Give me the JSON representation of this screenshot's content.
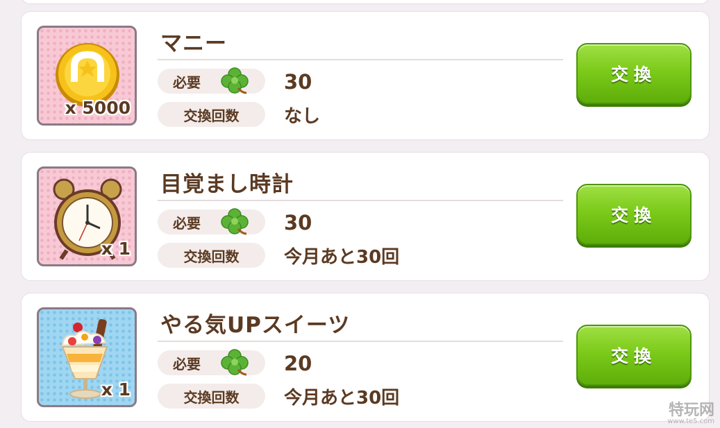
{
  "items": [
    {
      "name": "マニー",
      "quantity": "x 5000",
      "icon": "coin-icon",
      "required_label": "必要",
      "required_value": "30",
      "count_label": "交換回数",
      "count_value": "なし",
      "button_label": "交換"
    },
    {
      "name": "目覚まし時計",
      "quantity": "x 1",
      "icon": "alarm-clock-icon",
      "required_label": "必要",
      "required_value": "30",
      "count_label": "交換回数",
      "count_value": "今月あと30回",
      "button_label": "交換"
    },
    {
      "name": "やる気UPスイーツ",
      "quantity": "x 1",
      "icon": "parfait-icon",
      "required_label": "必要",
      "required_value": "20",
      "count_label": "交換回数",
      "count_value": "今月あと30回",
      "button_label": "交換"
    }
  ],
  "watermark": {
    "main": "特玩网",
    "sub": "www.te5.com"
  },
  "colors": {
    "button_green": "#7cca1a",
    "text_brown": "#5b3a22",
    "clover_green": "#5bb336"
  }
}
